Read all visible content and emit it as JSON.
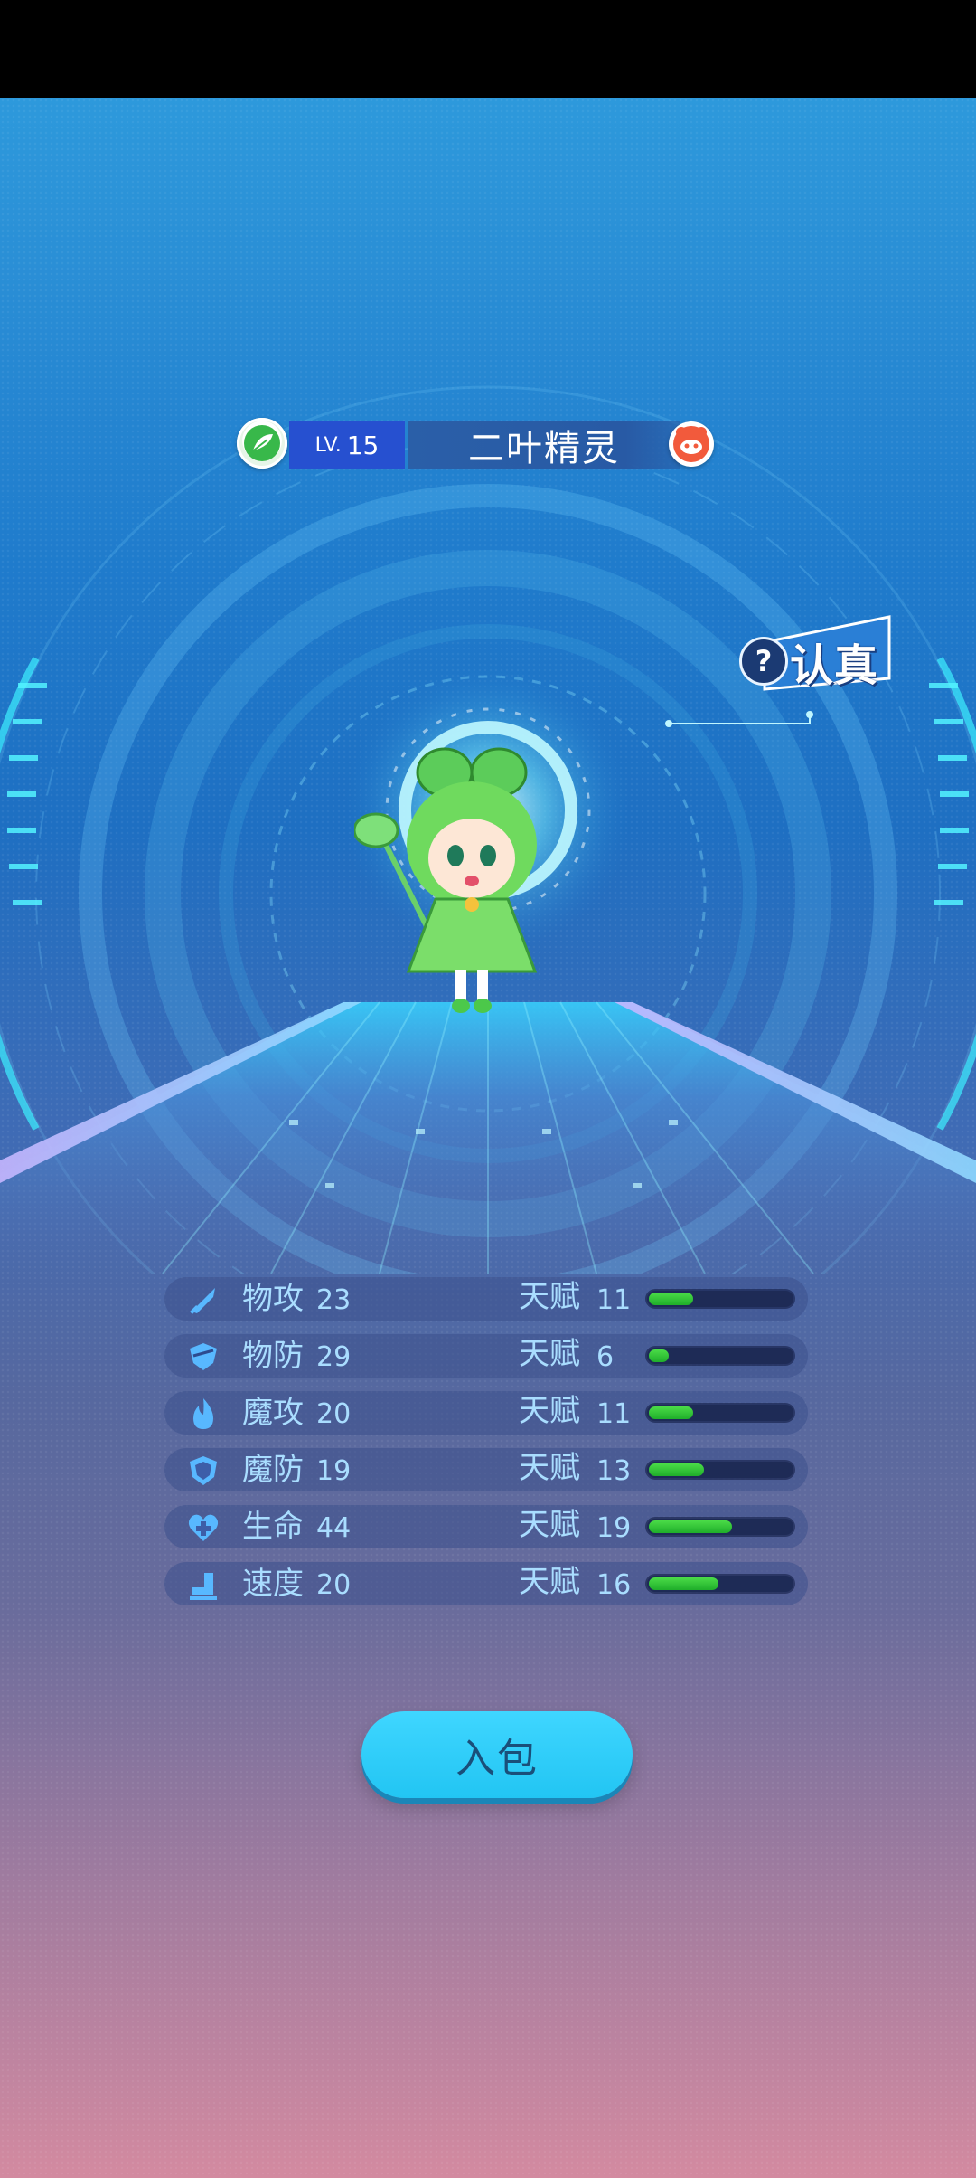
{
  "pet": {
    "level_prefix": "LV.",
    "level": "15",
    "name": "二叶精灵"
  },
  "trait": {
    "help_glyph": "?",
    "label": "认真"
  },
  "stats": [
    {
      "icon": "sword-icon",
      "name": "物攻",
      "value": "23",
      "talent_label": "天赋",
      "talent": "11",
      "talent_fill": 0.33
    },
    {
      "icon": "shield-icon",
      "name": "物防",
      "value": "29",
      "talent_label": "天赋",
      "talent": "6",
      "talent_fill": 0.16
    },
    {
      "icon": "fire-icon",
      "name": "魔攻",
      "value": "20",
      "talent_label": "天赋",
      "talent": "11",
      "talent_fill": 0.33
    },
    {
      "icon": "magic-shield-icon",
      "name": "魔防",
      "value": "19",
      "talent_label": "天赋",
      "talent": "13",
      "talent_fill": 0.4
    },
    {
      "icon": "heart-plus-icon",
      "name": "生命",
      "value": "44",
      "talent_label": "天赋",
      "talent": "19",
      "talent_fill": 0.59
    },
    {
      "icon": "boot-icon",
      "name": "速度",
      "value": "20",
      "talent_label": "天赋",
      "talent": "16",
      "talent_fill": 0.5
    }
  ],
  "actions": {
    "add_to_bag": "入包"
  },
  "colors": {
    "accent_cyan": "#22c5f3",
    "level_blue": "#2650d0",
    "bar_green": "#3ccf3a",
    "bar_track": "#1e2b56"
  }
}
